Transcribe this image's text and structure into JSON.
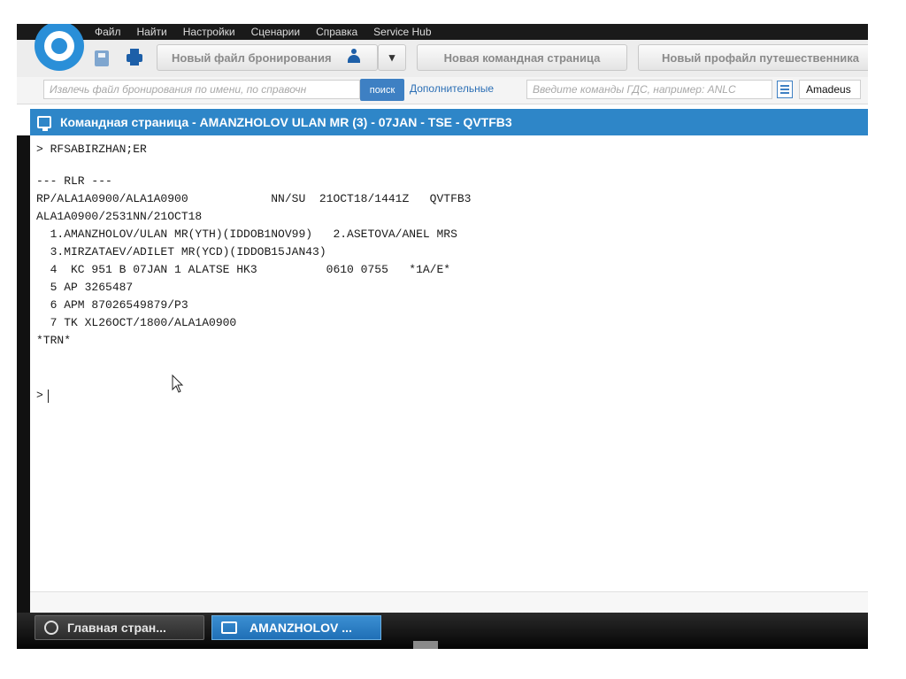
{
  "menu": {
    "items": [
      "Файл",
      "Найти",
      "Настройки",
      "Сценарии",
      "Справка",
      "Service Hub"
    ]
  },
  "toolbar": {
    "new_booking_file": "Новый файл бронирования",
    "new_command_page": "Новая командная страница",
    "new_traveler_profile": "Новый профайл путешественника"
  },
  "search": {
    "placeholder": "Извлечь файл бронирования по имени, по справочн",
    "button": "поиск",
    "advanced_link": "Дополнительные",
    "command_placeholder": "Введите команды ГДС, например: ANLC",
    "provider": "Amadeus"
  },
  "window": {
    "title": "Командная страница - AMANZHOLOV ULAN MR (3) - 07JAN - TSE - QVTFB3"
  },
  "terminal": {
    "lines": [
      "> RFSABIRZHAN;ER",
      "",
      "--- RLR ---",
      "RP/ALA1A0900/ALA1A0900            NN/SU  21OCT18/1441Z   QVTFB3",
      "ALA1A0900/2531NN/21OCT18",
      "  1.AMANZHOLOV/ULAN MR(YTH)(IDDOB1NOV99)   2.ASETOVA/ANEL MRS",
      "  3.MIRZATAEV/ADILET MR(YCD)(IDDOB15JAN43)",
      "  4  KC 951 B 07JAN 1 ALATSE HK3          0610 0755   *1A/E*",
      "  5 AP 3265487",
      "  6 APM 87026549879/P3",
      "  7 TK XL26OCT/1800/ALA1A0900",
      "*TRN*",
      "",
      ">"
    ]
  },
  "taskbar": {
    "items": [
      "Главная стран...",
      "AMANZHOLOV ..."
    ],
    "active_index": 1
  },
  "colors": {
    "accent": "#2e86c8",
    "menubar": "#1a1a1a",
    "taskbar_active": "#2b7cc2"
  },
  "icons": [
    "amadeus-logo-icon",
    "save-icon",
    "print-icon",
    "person-icon",
    "dropdown-arrow-icon",
    "list-icon",
    "terminal-icon",
    "mouse-pointer-icon"
  ]
}
